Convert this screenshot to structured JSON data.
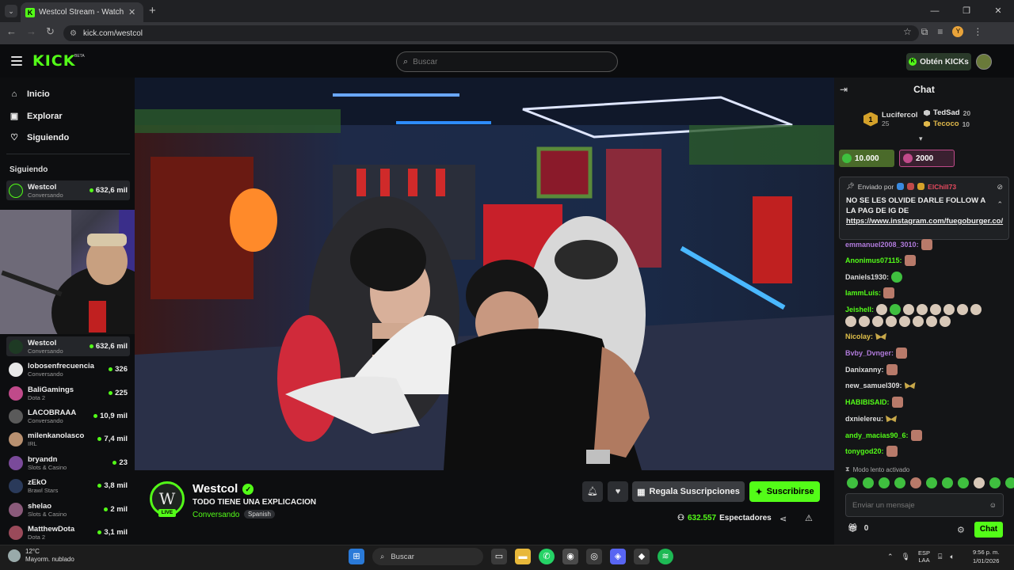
{
  "browser": {
    "tab_title": "Westcol Stream - Watch Li...",
    "url": "kick.com/westcol",
    "profile_initial": "Y"
  },
  "header": {
    "logo": "KICK",
    "beta": "BETA",
    "search_placeholder": "Buscar",
    "get_kicks": "Obtén KICKs"
  },
  "sidebar": {
    "nav": [
      {
        "label": "Inicio",
        "icon": "home-icon"
      },
      {
        "label": "Explorar",
        "icon": "compass-icon"
      },
      {
        "label": "Siguiendo",
        "icon": "heart-icon"
      }
    ],
    "following_header": "Siguiendo",
    "top_item": {
      "name": "Westcol",
      "category": "Conversando",
      "viewers": "632,6 mil"
    },
    "following": [
      {
        "name": "Westcol",
        "category": "Conversando",
        "viewers": "632,6 mil",
        "color": "#1e3a24"
      },
      {
        "name": "lobosenfrecuencia",
        "category": "Conversando",
        "viewers": "326",
        "color": "#e8e8e8"
      },
      {
        "name": "BaliGamings",
        "category": "Dota 2",
        "viewers": "225",
        "color": "#c04a8a"
      },
      {
        "name": "LACOBRAAA",
        "category": "Conversando",
        "viewers": "10,9 mil",
        "color": "#5a5a5a"
      },
      {
        "name": "milenkanolasco",
        "category": "IRL",
        "viewers": "7,4 mil",
        "color": "#b89070"
      },
      {
        "name": "bryandn",
        "category": "Slots & Casino",
        "viewers": "23",
        "color": "#7a4a9a"
      },
      {
        "name": "zEkO",
        "category": "Brawl Stars",
        "viewers": "3,8 mil",
        "color": "#2a3a5a"
      },
      {
        "name": "shelao",
        "category": "Slots & Casino",
        "viewers": "2 mil",
        "color": "#8a5a7a"
      },
      {
        "name": "MatthewDota",
        "category": "Dota 2",
        "viewers": "3,1 mil",
        "color": "#9a4a5a"
      }
    ]
  },
  "stream": {
    "name": "Westcol",
    "title": "TODO TIENE UNA EXPLICACION",
    "category": "Conversando",
    "language": "Spanish",
    "live": "LIVE",
    "gift_label": "Regala Suscripciones",
    "subscribe_label": "Suscribirse",
    "viewers": "632.557",
    "viewers_label": "Espectadores"
  },
  "chat": {
    "title": "Chat",
    "leader_first": {
      "rank": "1",
      "name": "Lucifercol",
      "value": "25"
    },
    "leaders": [
      {
        "name": "TedSad",
        "value": "20",
        "color": "#dddddd"
      },
      {
        "name": "Tecoco",
        "value": "10",
        "color": "#e0b84a"
      }
    ],
    "kick_boxes": [
      {
        "value": "10.000",
        "color": "#4a6a2a"
      },
      {
        "value": "2000",
        "color": "#3a2030"
      }
    ],
    "pinned": {
      "sent_by": "Enviado por",
      "user": "ElChill73",
      "message": "NO SE LES OLVIDE DARLE FOLLOW A LA PAG DE IG DE",
      "link": "https://www.instagram.com/fuegoburger.co/"
    },
    "messages": [
      {
        "user": "emmanuel2008_3010:",
        "color": "#b07adb",
        "emotes": [
          "f"
        ]
      },
      {
        "user": "Anonimus07115:",
        "color": "#53fc18",
        "emotes": [
          "f"
        ]
      },
      {
        "user": "Daniels1930:",
        "color": "#dddddd",
        "emotes": [
          "g"
        ]
      },
      {
        "user": "IammLuis:",
        "color": "#53fc18",
        "emotes": [
          "f"
        ]
      },
      {
        "user": "Jeishell:",
        "color": "#53fc18",
        "emotes": [
          "face",
          "g",
          "face",
          "face",
          "face",
          "face",
          "face",
          "face"
        ]
      },
      {
        "user": "",
        "color": "#53fc18",
        "emotes": [
          "face",
          "face",
          "face",
          "face",
          "face",
          "face",
          "face",
          "face"
        ]
      },
      {
        "user": "Nicolay:",
        "color": "#e0c04a",
        "emotes": [
          "moth"
        ]
      },
      {
        "user": "Bvby_Dvnger:",
        "color": "#b07adb",
        "emotes": [
          "f"
        ]
      },
      {
        "user": "Danixanny:",
        "color": "#dddddd",
        "emotes": [
          "f"
        ]
      },
      {
        "user": "new_samuel309:",
        "color": "#dddddd",
        "emotes": [
          "moth"
        ]
      },
      {
        "user": "HABIBISAID:",
        "color": "#53fc18",
        "emotes": [
          "f"
        ]
      },
      {
        "user": "dxnielereu:",
        "color": "#dddddd",
        "emotes": [
          "moth"
        ]
      },
      {
        "user": "andy_macias90_6:",
        "color": "#53fc18",
        "emotes": [
          "f"
        ]
      },
      {
        "user": "tonygod20:",
        "color": "#53fc18",
        "emotes": [
          "f"
        ]
      }
    ],
    "slow_mode": "Modo lento activado",
    "input_placeholder": "Enviar un mensaje",
    "kicks_count": "0",
    "chat_button": "Chat"
  },
  "taskbar": {
    "temp": "12°C",
    "weather": "Mayorm. nublado",
    "search": "Buscar",
    "lang1": "ESP",
    "lang2": "LAA",
    "time": "9:56 p. m.",
    "date": "1/01/2026"
  }
}
